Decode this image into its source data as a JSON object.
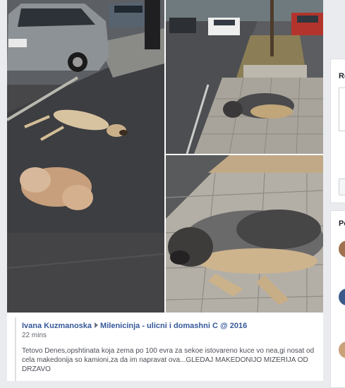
{
  "post": {
    "author": "Ivana Kuzmanoska",
    "page": "Milenicinja - ulicni i domashni C @ 2016",
    "time": "22 mins",
    "text": "Tetovo Denes,opshtinata koja zema po 100 evra za sekoe istovareno kuce vo nea,gi nosat od cela makedonija so kamioni,za da im napravat ova...GLEDAJ MAKEDONIJO MIZERIJA OD DRZAVO"
  },
  "photos": [
    {
      "subject": "dogs lying on street next to parked cars"
    },
    {
      "subject": "dog lying on sidewalk beside road"
    },
    {
      "subject": "dog lying on sidewalk close-up"
    }
  ],
  "sidebar": {
    "card1_title": "Re",
    "card2_title": "Pe"
  },
  "colors": {
    "link": "#365899",
    "background": "#e9ebee"
  }
}
